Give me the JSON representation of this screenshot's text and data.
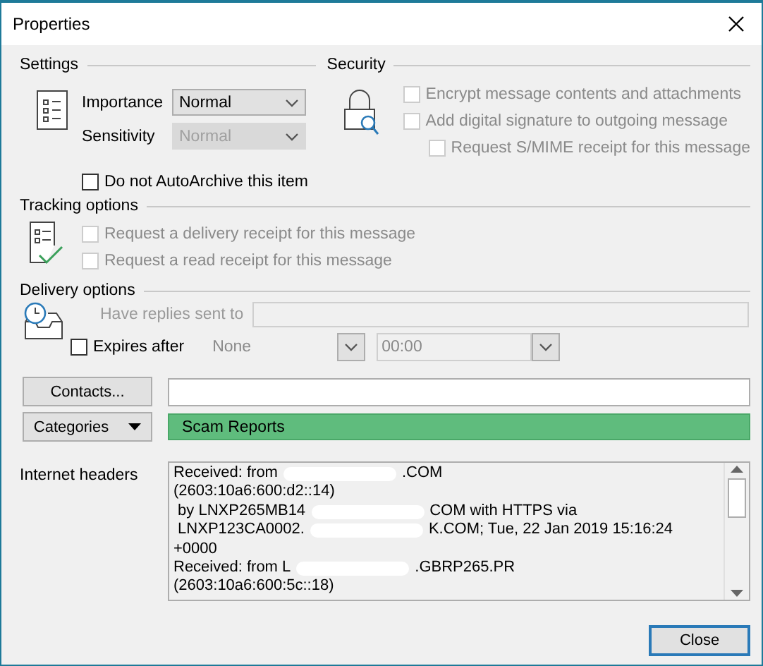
{
  "window": {
    "title": "Properties"
  },
  "settings": {
    "title": "Settings",
    "fields": [
      {
        "label": "Importance",
        "value": "Normal",
        "disabled": false
      },
      {
        "label": "Sensitivity",
        "value": "Normal",
        "disabled": true
      }
    ],
    "autoarchive": {
      "label": "Do not AutoArchive this item",
      "checked": false,
      "disabled": false
    }
  },
  "security": {
    "title": "Security",
    "options": [
      {
        "label": "Encrypt message contents and attachments",
        "checked": false,
        "disabled": true
      },
      {
        "label": "Add digital signature to outgoing message",
        "checked": false,
        "disabled": true,
        "children": [
          {
            "label": "Request S/MIME receipt for this message",
            "checked": false,
            "disabled": true
          }
        ]
      }
    ]
  },
  "tracking": {
    "title": "Tracking options",
    "options": [
      {
        "label": "Request a delivery receipt for this message",
        "checked": false,
        "disabled": true
      },
      {
        "label": "Request a read receipt for this message",
        "checked": false,
        "disabled": true
      }
    ]
  },
  "delivery": {
    "title": "Delivery options",
    "replies": {
      "label": "Have replies sent to",
      "disabled": true
    },
    "expires": {
      "label": "Expires after",
      "checked": false,
      "date": "None",
      "time": "00:00"
    }
  },
  "contacts": {
    "button": "Contacts..."
  },
  "categories": {
    "button": "Categories",
    "value": "Scam Reports"
  },
  "headers": {
    "label": "Internet headers",
    "lines": [
      [
        "Received: from",
        ".COM"
      ],
      [
        "(2603:10a6:600:d2::14)"
      ],
      [
        " by LNXP265MB14",
        "COM with HTTPS via"
      ],
      [
        " LNXP123CA0002.",
        "K.COM; Tue, 22 Jan 2019 15:16:24"
      ],
      [
        "+0000"
      ],
      [
        "Received: from L",
        ".GBRP265.PR"
      ],
      [
        "(2603:10a6:600:5c::18)"
      ]
    ]
  },
  "buttons": [
    "Close"
  ]
}
